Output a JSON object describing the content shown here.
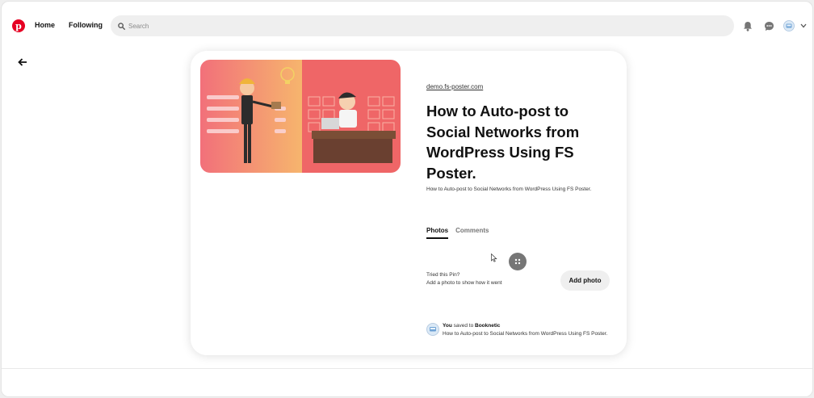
{
  "topnav": {
    "logo_letter": "p",
    "home_label": "Home",
    "following_label": "Following",
    "search_placeholder": "Search",
    "icons": [
      "notifications-icon",
      "messages-icon",
      "profile-avatar",
      "chevron-down-icon"
    ]
  },
  "pin": {
    "domain": "demo.fs-poster.com",
    "title": "How to Auto-post to Social Networks from WordPress Using FS Poster.",
    "description": "How to Auto-post to Social Networks from WordPress Using FS Poster.",
    "tabs": [
      {
        "label": "Photos",
        "active": true
      },
      {
        "label": "Comments",
        "active": false
      }
    ],
    "tried_title": "Tried this Pin?",
    "tried_subtitle": "Add a photo to show how it went",
    "add_photo_label": "Add photo",
    "saved": {
      "user": "You",
      "middle": "saved to",
      "board": "Booknetic",
      "pin_title": "How to Auto-post to Social Networks from WordPress Using FS Poster."
    }
  },
  "colors": {
    "brand": "#e60023",
    "image_left": "#f5a66a",
    "image_right": "#f06a68"
  }
}
